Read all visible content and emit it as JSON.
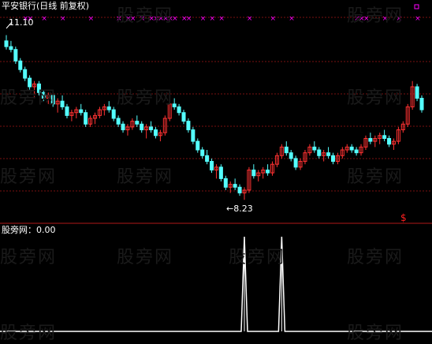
{
  "title": "平安银行(日线 前复权)",
  "watermark": "股旁网",
  "indicator_label": "股旁网：0.00",
  "high_label": "11.10",
  "low_label": "←8.23",
  "signal_glyph": "$",
  "colors": {
    "background": "#000000",
    "up": "#ff3232",
    "down": "#54ffff",
    "grid": "#7a1010",
    "divider": "#b01818",
    "marker": "#ff00ff",
    "signal": "#ff2020",
    "indicator_line": "#ffffff"
  },
  "chart_data": [
    {
      "type": "candlestick",
      "title": "平安银行(日线 前复权)",
      "price_range": [
        8.0,
        11.3
      ],
      "high_annotation": 11.1,
      "low_annotation": 8.23,
      "grid": true,
      "candles": [
        [
          11.0,
          11.1,
          10.85,
          10.9
        ],
        [
          10.9,
          11.0,
          10.8,
          10.85
        ],
        [
          10.85,
          10.9,
          10.6,
          10.65
        ],
        [
          10.65,
          10.7,
          10.45,
          10.5
        ],
        [
          10.5,
          10.55,
          10.3,
          10.35
        ],
        [
          10.35,
          10.4,
          10.15,
          10.2
        ],
        [
          10.2,
          10.3,
          10.0,
          10.25
        ],
        [
          10.25,
          10.3,
          10.05,
          10.1
        ],
        [
          10.1,
          10.15,
          9.95,
          10.0
        ],
        [
          10.0,
          10.1,
          9.9,
          10.05
        ],
        [
          10.05,
          10.1,
          9.85,
          9.9
        ],
        [
          9.9,
          10.0,
          9.75,
          9.95
        ],
        [
          9.95,
          10.05,
          9.8,
          9.85
        ],
        [
          9.85,
          9.9,
          9.65,
          9.7
        ],
        [
          9.7,
          9.8,
          9.6,
          9.75
        ],
        [
          9.75,
          9.85,
          9.65,
          9.8
        ],
        [
          9.8,
          9.9,
          9.7,
          9.75
        ],
        [
          9.75,
          9.8,
          9.5,
          9.55
        ],
        [
          9.55,
          9.7,
          9.5,
          9.65
        ],
        [
          9.65,
          9.75,
          9.55,
          9.7
        ],
        [
          9.7,
          9.85,
          9.65,
          9.8
        ],
        [
          9.8,
          9.9,
          9.7,
          9.85
        ],
        [
          9.85,
          9.95,
          9.75,
          9.8
        ],
        [
          9.8,
          9.85,
          9.6,
          9.65
        ],
        [
          9.65,
          9.7,
          9.5,
          9.55
        ],
        [
          9.55,
          9.6,
          9.4,
          9.45
        ],
        [
          9.45,
          9.55,
          9.35,
          9.5
        ],
        [
          9.5,
          9.65,
          9.45,
          9.6
        ],
        [
          9.6,
          9.7,
          9.5,
          9.55
        ],
        [
          9.55,
          9.6,
          9.4,
          9.45
        ],
        [
          9.45,
          9.55,
          9.3,
          9.5
        ],
        [
          9.5,
          9.6,
          9.4,
          9.45
        ],
        [
          9.45,
          9.5,
          9.3,
          9.35
        ],
        [
          9.35,
          9.45,
          9.25,
          9.4
        ],
        [
          9.4,
          9.7,
          9.35,
          9.65
        ],
        [
          9.65,
          9.95,
          9.6,
          9.9
        ],
        [
          9.9,
          10.0,
          9.8,
          9.85
        ],
        [
          9.85,
          9.9,
          9.7,
          9.75
        ],
        [
          9.75,
          9.8,
          9.55,
          9.6
        ],
        [
          9.6,
          9.65,
          9.4,
          9.45
        ],
        [
          9.45,
          9.5,
          9.2,
          9.25
        ],
        [
          9.25,
          9.3,
          9.05,
          9.1
        ],
        [
          9.1,
          9.15,
          8.95,
          9.0
        ],
        [
          9.0,
          9.1,
          8.85,
          8.9
        ],
        [
          8.9,
          8.95,
          8.7,
          8.75
        ],
        [
          8.75,
          8.85,
          8.6,
          8.8
        ],
        [
          8.8,
          8.85,
          8.55,
          8.6
        ],
        [
          8.6,
          8.65,
          8.4,
          8.45
        ],
        [
          8.45,
          8.55,
          8.35,
          8.5
        ],
        [
          8.5,
          8.6,
          8.4,
          8.45
        ],
        [
          8.45,
          8.5,
          8.3,
          8.35
        ],
        [
          8.35,
          8.45,
          8.23,
          8.4
        ],
        [
          8.4,
          8.8,
          8.35,
          8.75
        ],
        [
          8.75,
          8.85,
          8.6,
          8.65
        ],
        [
          8.65,
          8.75,
          8.55,
          8.7
        ],
        [
          8.7,
          8.8,
          8.6,
          8.75
        ],
        [
          8.75,
          8.85,
          8.65,
          8.7
        ],
        [
          8.7,
          8.9,
          8.65,
          8.85
        ],
        [
          8.85,
          9.05,
          8.8,
          9.0
        ],
        [
          9.0,
          9.2,
          8.95,
          9.15
        ],
        [
          9.15,
          9.25,
          9.0,
          9.05
        ],
        [
          9.05,
          9.1,
          8.9,
          8.95
        ],
        [
          8.95,
          9.0,
          8.75,
          8.8
        ],
        [
          8.8,
          8.95,
          8.75,
          8.9
        ],
        [
          8.9,
          9.1,
          8.85,
          9.05
        ],
        [
          9.05,
          9.2,
          9.0,
          9.15
        ],
        [
          9.15,
          9.25,
          9.05,
          9.1
        ],
        [
          9.1,
          9.15,
          8.95,
          9.0
        ],
        [
          9.0,
          9.1,
          8.9,
          9.05
        ],
        [
          9.05,
          9.15,
          8.95,
          9.0
        ],
        [
          9.0,
          9.05,
          8.85,
          8.9
        ],
        [
          8.9,
          9.05,
          8.85,
          9.0
        ],
        [
          9.0,
          9.15,
          8.95,
          9.1
        ],
        [
          9.1,
          9.2,
          9.05,
          9.15
        ],
        [
          9.15,
          9.2,
          9.05,
          9.1
        ],
        [
          9.1,
          9.15,
          9.0,
          9.05
        ],
        [
          9.05,
          9.2,
          9.0,
          9.15
        ],
        [
          9.15,
          9.35,
          9.1,
          9.3
        ],
        [
          9.3,
          9.4,
          9.2,
          9.25
        ],
        [
          9.25,
          9.35,
          9.15,
          9.3
        ],
        [
          9.3,
          9.4,
          9.2,
          9.35
        ],
        [
          9.35,
          9.45,
          9.25,
          9.3
        ],
        [
          9.3,
          9.35,
          9.15,
          9.2
        ],
        [
          9.2,
          9.3,
          9.1,
          9.25
        ],
        [
          9.25,
          9.5,
          9.2,
          9.45
        ],
        [
          9.45,
          9.6,
          9.4,
          9.55
        ],
        [
          9.55,
          9.9,
          9.5,
          9.85
        ],
        [
          9.85,
          10.3,
          9.8,
          10.2
        ],
        [
          10.2,
          10.25,
          9.95,
          10.0
        ],
        [
          10.0,
          10.05,
          9.75,
          9.8
        ]
      ],
      "markers": "magenta × signals along top edge"
    },
    {
      "type": "line",
      "name": "股旁网",
      "values_desc": "two spikes to 1.0 near bars 51 and 59, otherwise 0",
      "spikes_at": [
        51,
        59
      ],
      "ylim": [
        0,
        1
      ]
    }
  ]
}
